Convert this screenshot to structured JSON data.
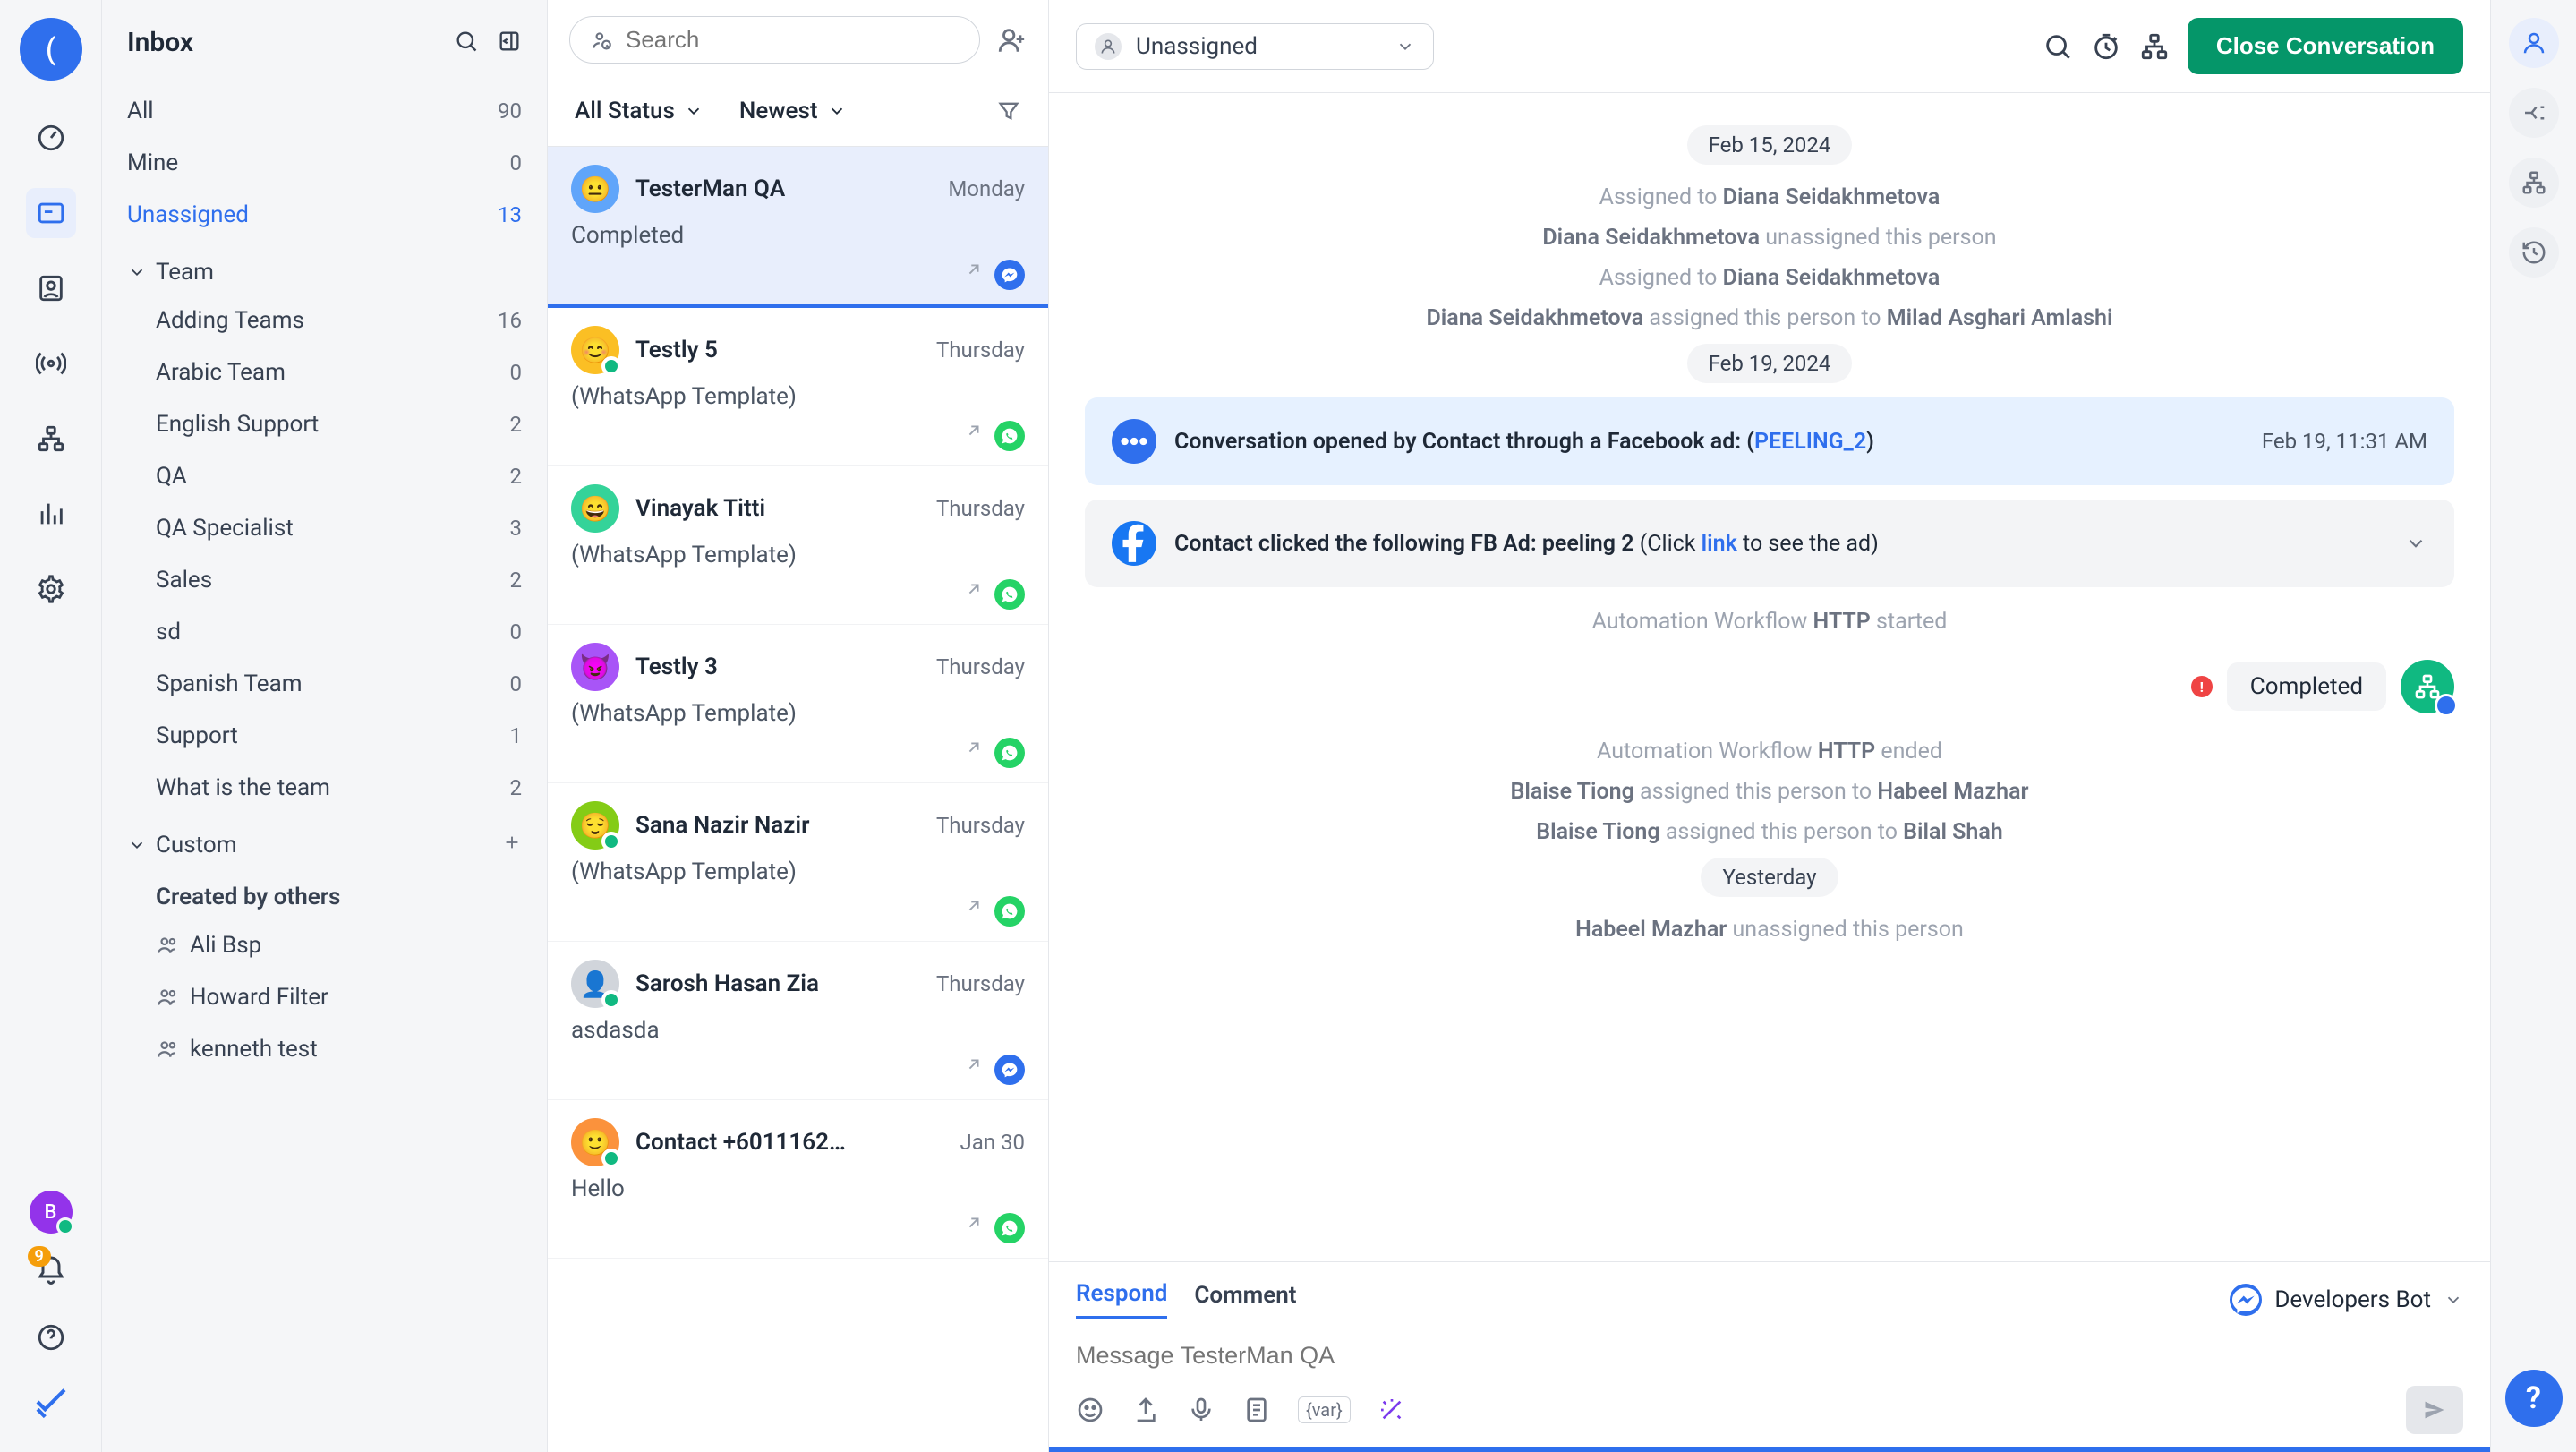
{
  "sidebar": {
    "title": "Inbox",
    "items": [
      {
        "label": "All",
        "count": "90"
      },
      {
        "label": "Mine",
        "count": "0"
      },
      {
        "label": "Unassigned",
        "count": "13"
      }
    ],
    "team_group": "Team",
    "teams": [
      {
        "label": "Adding Teams",
        "count": "16"
      },
      {
        "label": "Arabic Team",
        "count": "0"
      },
      {
        "label": "English Support",
        "count": "2"
      },
      {
        "label": "QA",
        "count": "2"
      },
      {
        "label": "QA Specialist",
        "count": "3"
      },
      {
        "label": "Sales",
        "count": "2"
      },
      {
        "label": "sd",
        "count": "0"
      },
      {
        "label": "Spanish Team",
        "count": "0"
      },
      {
        "label": "Support",
        "count": "1"
      },
      {
        "label": "What is the team",
        "count": "2"
      }
    ],
    "custom_group": "Custom",
    "others_heading": "Created by others",
    "others": [
      {
        "label": "Ali Bsp"
      },
      {
        "label": "Howard Filter"
      },
      {
        "label": "kenneth test"
      }
    ]
  },
  "rail": {
    "workspace_initial": "(",
    "user_initial": "B",
    "notif_count": "9"
  },
  "search": {
    "placeholder": "Search"
  },
  "filters": {
    "status": "All Status",
    "sort": "Newest"
  },
  "conversations": [
    {
      "name": "TesterMan QA",
      "time": "Monday",
      "preview": "Completed",
      "channel": "messenger",
      "avatar": "blue",
      "selected": true,
      "online": false
    },
    {
      "name": "Testly 5",
      "time": "Thursday",
      "preview": "(WhatsApp Template)",
      "channel": "whatsapp",
      "avatar": "yellow",
      "selected": false,
      "online": true
    },
    {
      "name": "Vinayak Titti",
      "time": "Thursday",
      "preview": "(WhatsApp Template)",
      "channel": "whatsapp",
      "avatar": "green",
      "selected": false,
      "online": false
    },
    {
      "name": "Testly 3",
      "time": "Thursday",
      "preview": "(WhatsApp Template)",
      "channel": "whatsapp",
      "avatar": "purple",
      "selected": false,
      "online": false
    },
    {
      "name": "Sana Nazir Nazir",
      "time": "Thursday",
      "preview": "(WhatsApp Template)",
      "channel": "whatsapp",
      "avatar": "lime",
      "selected": false,
      "online": true
    },
    {
      "name": "Sarosh Hasan Zia",
      "time": "Thursday",
      "preview": "asdasda",
      "channel": "messenger",
      "avatar": "pic",
      "selected": false,
      "online": true
    },
    {
      "name": "Contact +6011162…",
      "time": "Jan 30",
      "preview": "Hello",
      "channel": "whatsapp",
      "avatar": "orange",
      "selected": false,
      "online": true
    }
  ],
  "header": {
    "assignee": "Unassigned",
    "close_button": "Close Conversation"
  },
  "timeline": {
    "date1": "Feb 15, 2024",
    "assigned_to_1_prefix": "Assigned to ",
    "assigned_to_1_name": "Diana Seidakhmetova",
    "unassigned_1_name": "Diana Seidakhmetova",
    "unassigned_1_suffix": " unassigned this person",
    "assigned_to_2_prefix": "Assigned to ",
    "assigned_to_2_name": "Diana Seidakhmetova",
    "assigned_3_actor": "Diana Seidakhmetova",
    "assigned_3_middle": " assigned this person to ",
    "assigned_3_target": "Milad Asghari Amlashi",
    "date2": "Feb 19, 2024",
    "event_open_prefix": "Conversation opened by Contact through a Facebook ad: (",
    "event_open_link": "PEELING_2",
    "event_open_suffix": ")",
    "event_open_time": "Feb 19, 11:31 AM",
    "event_fb_prefix": "Contact clicked the following FB Ad: peeling 2 ",
    "event_fb_click": "(Click ",
    "event_fb_link": "link",
    "event_fb_suffix": " to see the ad)",
    "auto_start_prefix": "Automation Workflow ",
    "auto_start_name": "HTTP",
    "auto_start_suffix": " started",
    "msg_completed": "Completed",
    "auto_end_prefix": "Automation Workflow ",
    "auto_end_name": "HTTP",
    "auto_end_suffix": " ended",
    "assign_4_actor": "Blaise Tiong",
    "assign_4_middle": " assigned this person to ",
    "assign_4_target": "Habeel Mazhar",
    "assign_5_actor": "Blaise Tiong",
    "assign_5_middle": " assigned this person to ",
    "assign_5_target": "Bilal Shah",
    "date3": "Yesterday",
    "unassigned_2_name": "Habeel Mazhar",
    "unassigned_2_suffix": " unassigned this person"
  },
  "composer": {
    "respond_tab": "Respond",
    "comment_tab": "Comment",
    "channel_label": "Developers Bot",
    "placeholder": "Message TesterMan QA",
    "var_label": "{var}"
  }
}
